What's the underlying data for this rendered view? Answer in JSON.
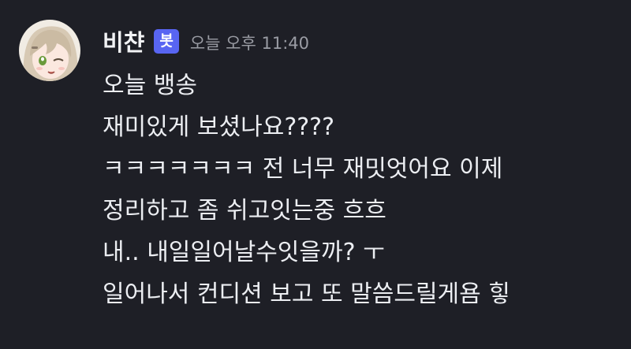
{
  "message": {
    "author": "비챤",
    "badge": "봇",
    "timestamp": "오늘 오후 11:40",
    "avatar_icon": "anime-girl-avatar",
    "lines": [
      "오늘 뱅송",
      "재미있게 보셨나요????",
      "ㅋㅋㅋㅋㅋㅋㅋ 전 너무 재밋엇어요 이제",
      "정리하고 좀 쉬고잇는중 흐흐",
      "내.. 내일일어날수잇을까? ㅜ",
      "일어나서 컨디션 보고 또 말씀드릴게욤 힣"
    ]
  },
  "colors": {
    "background": "#1e1f26",
    "text": "#eceef2",
    "username": "#f2f3f5",
    "badge": "#5865f2",
    "timestamp": "#9a9ca4"
  }
}
